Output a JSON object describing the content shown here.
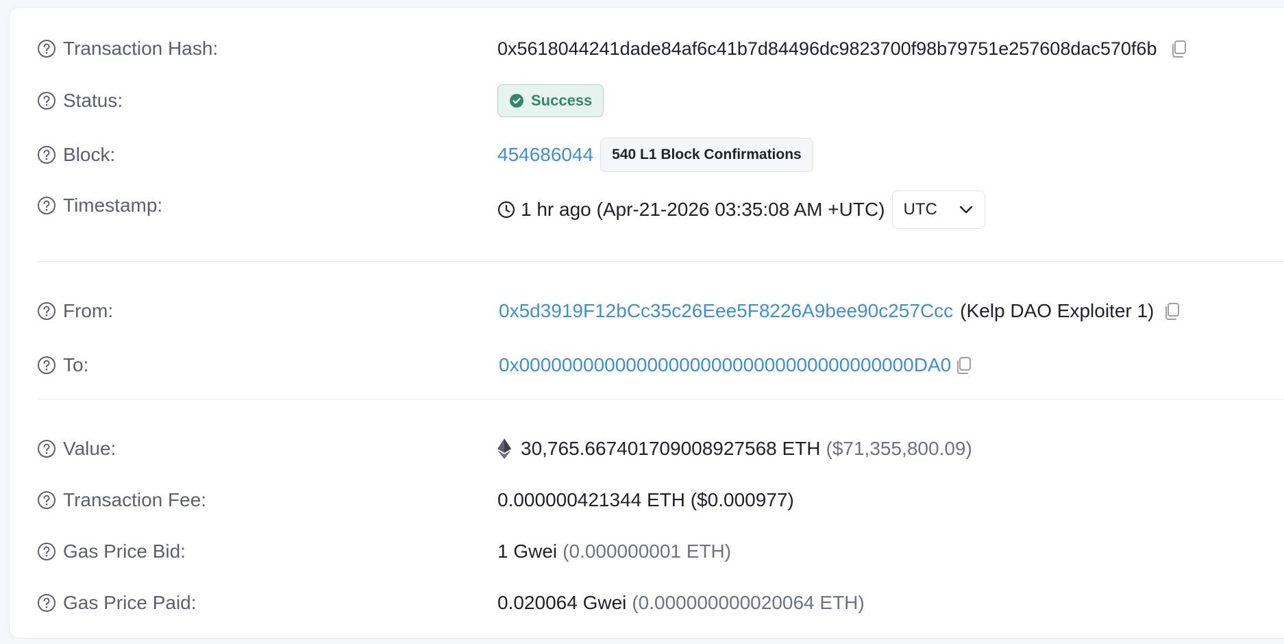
{
  "rows": {
    "tx_hash": {
      "label": "Transaction Hash:",
      "value": "0x5618044241dade84af6c41b7d84496dc9823700f98b79751e257608dac570f6b"
    },
    "status": {
      "label": "Status:",
      "value": "Success"
    },
    "block": {
      "label": "Block:",
      "number": "454686044",
      "confirmations": "540 L1 Block Confirmations"
    },
    "timestamp": {
      "label": "Timestamp:",
      "value": "1 hr ago (Apr-21-2026 03:35:08 AM +UTC)",
      "timezone": "UTC"
    },
    "from": {
      "label": "From:",
      "address": "0x5d3919F12bCc35c26Eee5F8226A9bee90c257Ccc",
      "name_tag": "(Kelp DAO Exploiter 1)"
    },
    "to": {
      "label": "To:",
      "address": "0x0000000000000000000000000000000000000DA0"
    },
    "value": {
      "label": "Value:",
      "amount": "30,765.667401709008927568 ETH",
      "usd": "($71,355,800.09)"
    },
    "fee": {
      "label": "Transaction Fee:",
      "value": "0.000000421344 ETH ($0.000977)"
    },
    "gas_bid": {
      "label": "Gas Price Bid:",
      "value": "1 Gwei",
      "eth": "(0.000000001 ETH)"
    },
    "gas_paid": {
      "label": "Gas Price Paid:",
      "value": "0.020064 Gwei",
      "eth": "(0.000000000020064 ETH)"
    }
  },
  "icons": {
    "help": "question-circle-icon",
    "copy": "copy-icon",
    "status": "check-circle-icon",
    "clock": "clock-icon",
    "eth": "ethereum-icon",
    "dropdown": "chevron-down-icon"
  },
  "colors": {
    "link": "#3d8fd9",
    "success_text": "#2f8a67",
    "success_bg": "#e6f3ee",
    "label": "#5b6069"
  }
}
